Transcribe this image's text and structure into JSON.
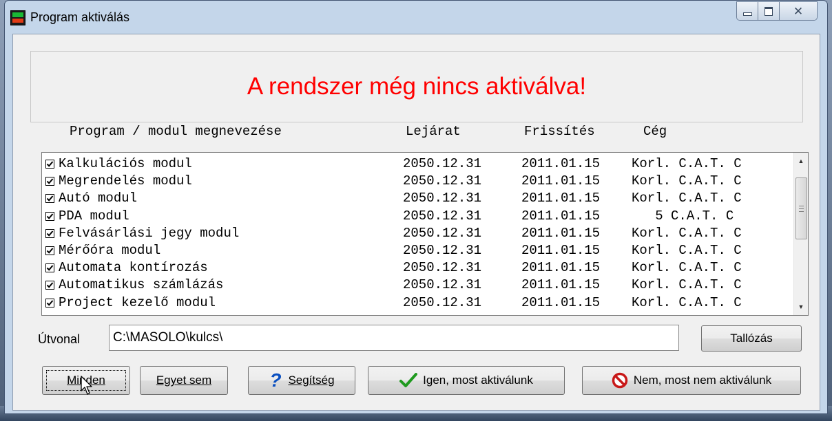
{
  "window": {
    "title": "Program aktiválás",
    "icon": "app-icon",
    "controls": [
      "minimize-icon",
      "maximize-icon",
      "close-icon"
    ]
  },
  "banner": {
    "message": "A rendszer még nincs aktiválva!",
    "color": "#ff0000"
  },
  "columns": {
    "name": "Program / modul megnevezése",
    "expiry": "Lejárat",
    "update": "Frissítés",
    "company": "Cég"
  },
  "modules": [
    {
      "checked": true,
      "name": "Kalkulációs modul",
      "expiry": "2050.12.31",
      "update": "2011.01.15",
      "company": "Korl. C.A.T. C"
    },
    {
      "checked": true,
      "name": "Megrendelés modul",
      "expiry": "2050.12.31",
      "update": "2011.01.15",
      "company": "Korl. C.A.T. C"
    },
    {
      "checked": true,
      "name": "Autó modul",
      "expiry": "2050.12.31",
      "update": "2011.01.15",
      "company": "Korl. C.A.T. C"
    },
    {
      "checked": true,
      "name": "PDA modul",
      "expiry": "2050.12.31",
      "update": "2011.01.15",
      "company": "   5 C.A.T. C"
    },
    {
      "checked": true,
      "name": "Felvásárlási jegy modul",
      "expiry": "2050.12.31",
      "update": "2011.01.15",
      "company": "Korl. C.A.T. C"
    },
    {
      "checked": true,
      "name": "Mérőóra modul",
      "expiry": "2050.12.31",
      "update": "2011.01.15",
      "company": "Korl. C.A.T. C"
    },
    {
      "checked": true,
      "name": "Automata kontírozás",
      "expiry": "2050.12.31",
      "update": "2011.01.15",
      "company": "Korl. C.A.T. C"
    },
    {
      "checked": true,
      "name": "Automatikus számlázás",
      "expiry": "2050.12.31",
      "update": "2011.01.15",
      "company": "Korl. C.A.T. C"
    },
    {
      "checked": true,
      "name": "Project kezelő modul",
      "expiry": "2050.12.31",
      "update": "2011.01.15",
      "company": "Korl. C.A.T. C"
    }
  ],
  "path": {
    "label": "Útvonal",
    "value": "C:\\MASOLO\\kulcs\\"
  },
  "buttons": {
    "browse": "Tallózás",
    "all": "Minden",
    "none": "Egyet sem",
    "help": "Segítség",
    "yes": "Igen, most aktiválunk",
    "no": "Nem, most nem aktiválunk"
  },
  "icons": {
    "help": "question-mark-icon",
    "yes": "checkmark-icon",
    "no": "prohibited-icon"
  },
  "colors": {
    "help_icon": "#0a4fc0",
    "check_icon": "#1f9a1f",
    "no_icon": "#c81818"
  }
}
